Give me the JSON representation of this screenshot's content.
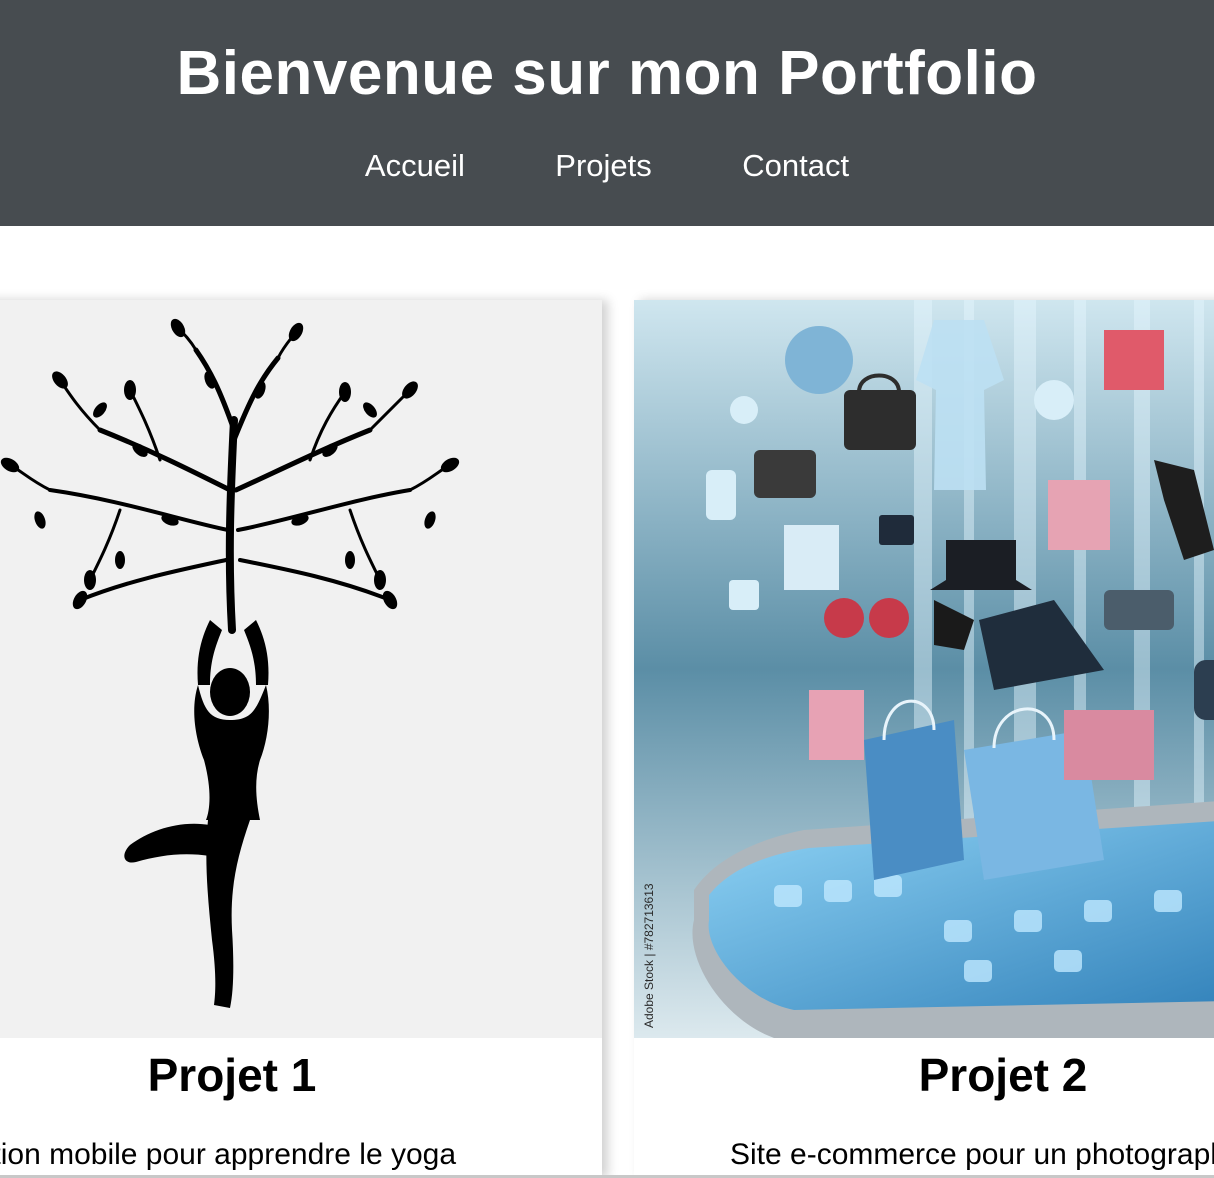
{
  "header": {
    "title": "Bienvenue sur mon Portfolio",
    "nav": [
      "Accueil",
      "Projets",
      "Contact"
    ]
  },
  "projects": [
    {
      "title": "Projet 1",
      "description": "Application mobile pour apprendre le yoga",
      "image": "yoga-tree-silhouette"
    },
    {
      "title": "Projet 2",
      "description": "Site e-commerce pour un photographe",
      "image": "ecommerce-smartphone-shopping",
      "watermark": "Adobe Stock | #782713613"
    }
  ],
  "colors": {
    "header_bg": "#474c50",
    "text": "#000000",
    "header_text": "#ffffff"
  }
}
